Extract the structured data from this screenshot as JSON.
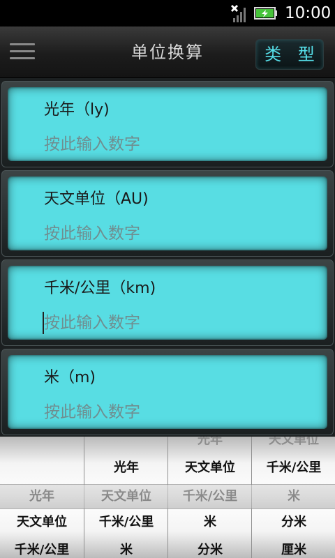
{
  "status_bar": {
    "time": "10:00",
    "icons": [
      "signal-icon",
      "battery-charging-icon"
    ]
  },
  "header": {
    "title": "单位换算",
    "type_button": "类 型",
    "menu_icon": "hamburger-menu-icon"
  },
  "converter": {
    "fields": [
      {
        "unit": "光年（ly)",
        "placeholder": "按此输入数字",
        "value": ""
      },
      {
        "unit": "天文单位（AU)",
        "placeholder": "按此输入数字",
        "value": ""
      },
      {
        "unit": "千米/公里（km)",
        "placeholder": "按此输入数字",
        "value": ""
      },
      {
        "unit": "米（m)",
        "placeholder": "按此输入数字",
        "value": ""
      }
    ]
  },
  "picker": {
    "columns": [
      [
        "",
        "",
        "光年",
        "天文单位",
        "千米/公里"
      ],
      [
        "",
        "光年",
        "天文单位",
        "千米/公里",
        "米"
      ],
      [
        "光年",
        "天文单位",
        "千米/公里",
        "米",
        "分米"
      ],
      [
        "天文单位",
        "千米/公里",
        "米",
        "分米",
        "厘米"
      ]
    ]
  },
  "colors": {
    "accent": "#58dde3",
    "type_button_text": "#56e0ea",
    "header_bg": "#1c1c1c"
  }
}
